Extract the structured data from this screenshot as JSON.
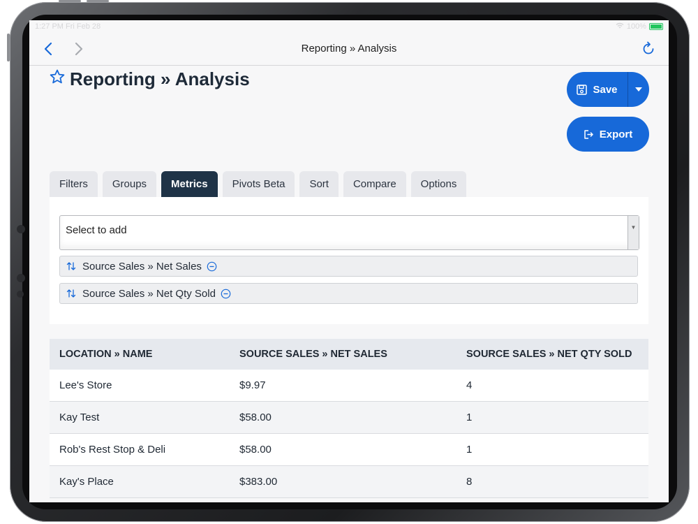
{
  "status_bar": {
    "time": "1:27 PM  Fri Feb 28",
    "battery": "100%"
  },
  "nav": {
    "title": "Reporting » Analysis"
  },
  "page": {
    "title": "Reporting » Analysis"
  },
  "actions": {
    "save_label": "Save",
    "export_label": "Export"
  },
  "tabs": [
    {
      "label": "Filters"
    },
    {
      "label": "Groups"
    },
    {
      "label": "Metrics",
      "active": true
    },
    {
      "label": "Pivots Beta"
    },
    {
      "label": "Sort"
    },
    {
      "label": "Compare"
    },
    {
      "label": "Options"
    }
  ],
  "metrics": {
    "select_placeholder": "Select to add",
    "items": [
      {
        "label": "Source Sales » Net Sales"
      },
      {
        "label": "Source Sales » Net Qty Sold"
      }
    ]
  },
  "table": {
    "headers": [
      "LOCATION » NAME",
      "SOURCE SALES » NET SALES",
      "SOURCE SALES » NET QTY SOLD"
    ],
    "rows": [
      [
        "Lee's Store",
        "$9.97",
        "4"
      ],
      [
        "Kay Test",
        "$58.00",
        "1"
      ],
      [
        "Rob's Rest Stop & Deli",
        "$58.00",
        "1"
      ],
      [
        "Kay's Place",
        "$383.00",
        "8"
      ]
    ]
  },
  "colors": {
    "accent": "#1769d9",
    "active_tab": "#1f3347",
    "header_bg": "#e6e9ee"
  }
}
